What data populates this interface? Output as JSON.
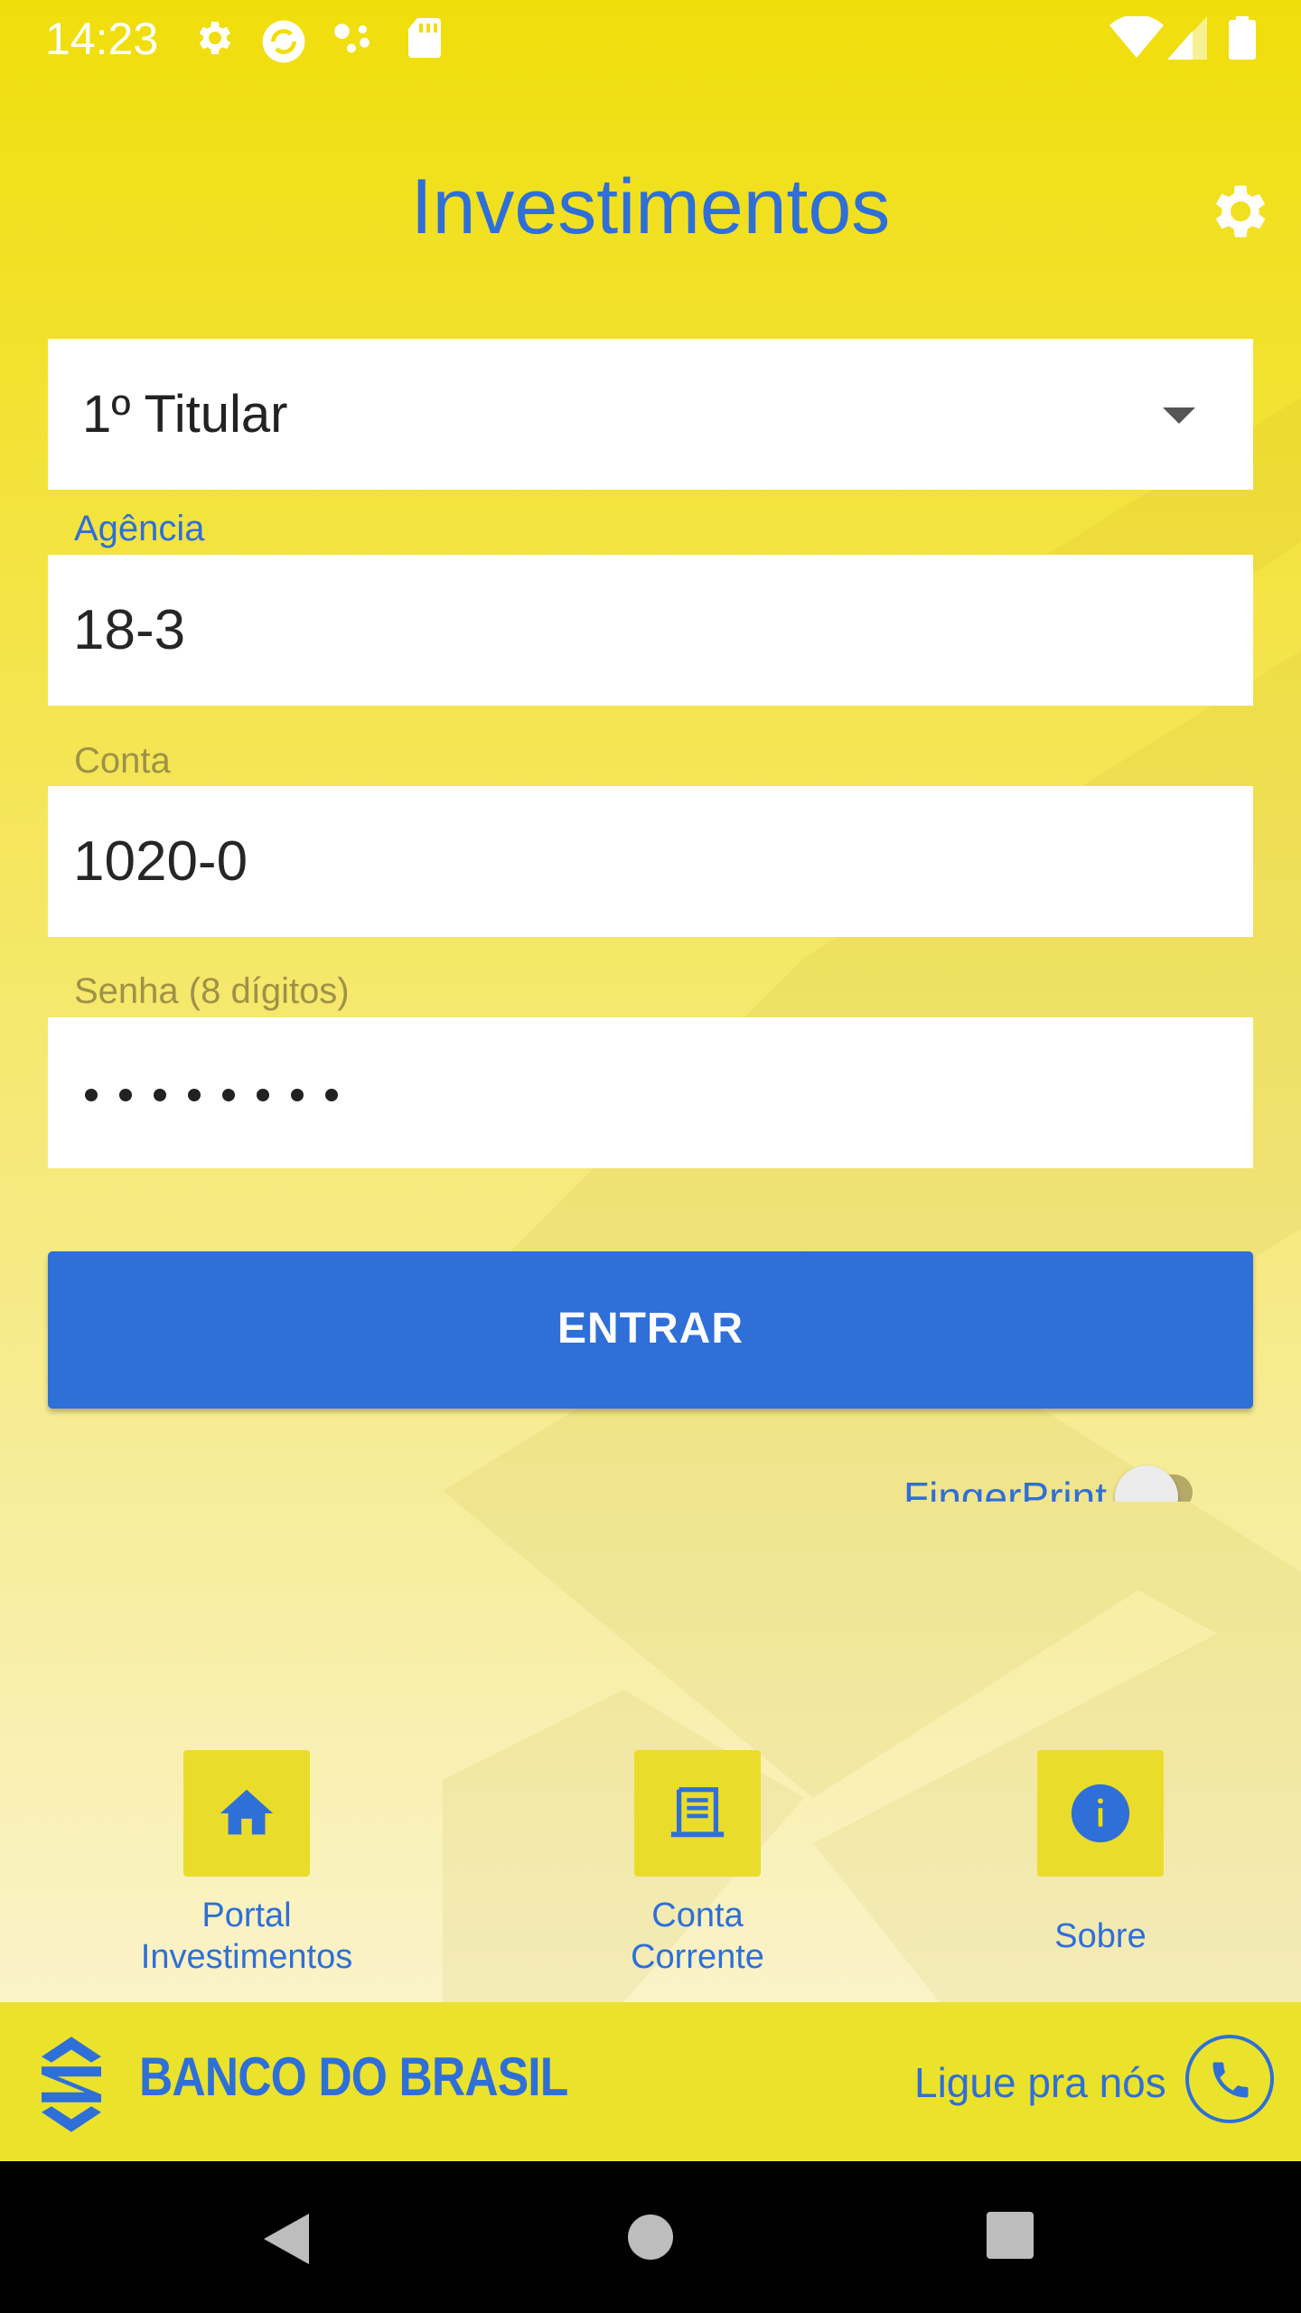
{
  "status_bar": {
    "time": "14:23",
    "left_icons": [
      "settings-icon",
      "sync-icon",
      "assistant-dots-icon",
      "sd-card-icon"
    ],
    "right_icons": [
      "wifi-icon",
      "cell-signal-icon",
      "battery-icon"
    ]
  },
  "header": {
    "title": "Investimentos",
    "settings_icon": "gear-icon"
  },
  "form": {
    "titular": {
      "value": "1º Titular",
      "icon": "dropdown-arrow-icon"
    },
    "agencia": {
      "label": "Agência",
      "value": "18-3"
    },
    "conta": {
      "label": "Conta",
      "value": "1020-0"
    },
    "senha": {
      "label": "Senha (8 dígitos)",
      "masked_length": 8
    }
  },
  "enter_button": {
    "label": "ENTRAR"
  },
  "fingerprint": {
    "label": "FingerPrint",
    "enabled": false
  },
  "quick_links": [
    {
      "line1": "Portal",
      "line2": "Investimentos",
      "icon": "home-icon"
    },
    {
      "line1": "Conta",
      "line2": "Corrente",
      "icon": "statement-icon"
    },
    {
      "line1": "Sobre",
      "line2": "",
      "icon": "info-icon"
    }
  ],
  "footer": {
    "brand": "BANCO DO BRASIL",
    "call_label": "Ligue pra nós",
    "call_icon": "phone-icon"
  },
  "colors": {
    "accent": "#2e6fd8",
    "brand_yellow": "#f0de0b",
    "footer_yellow": "#ebe22c"
  },
  "nav_bar": {
    "icons": [
      "back-icon",
      "home-circle-icon",
      "recents-square-icon"
    ]
  }
}
